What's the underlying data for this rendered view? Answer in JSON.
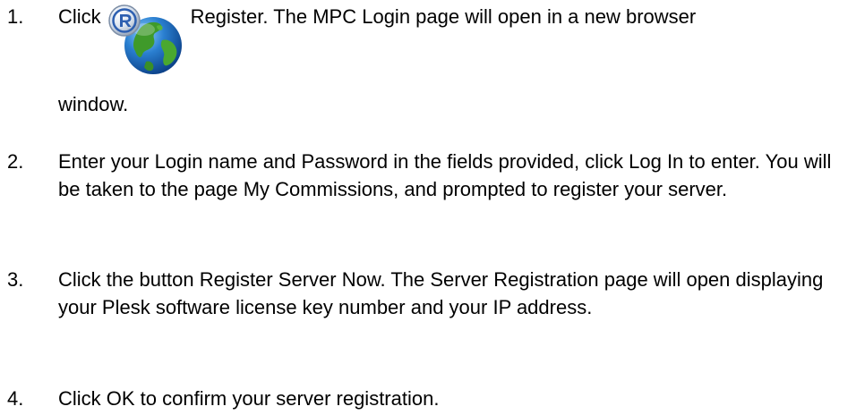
{
  "steps": [
    {
      "number": "1.",
      "before_icon": "Click",
      "icon": "register-globe-icon",
      "after_icon": "Register. The MPC Login page will open in a new browser",
      "continuation": "window."
    },
    {
      "number": "2.",
      "text": "Enter your Login name and Password in the fields provided, click Log In to enter. You will be taken to the page My Commissions, and prompted to register your server."
    },
    {
      "number": "3.",
      "text": "Click the button Register Server Now. The Server Registration page will open displaying your Plesk software license key number and your IP address."
    },
    {
      "number": "4.",
      "text": "Click OK to confirm your server registration."
    }
  ]
}
